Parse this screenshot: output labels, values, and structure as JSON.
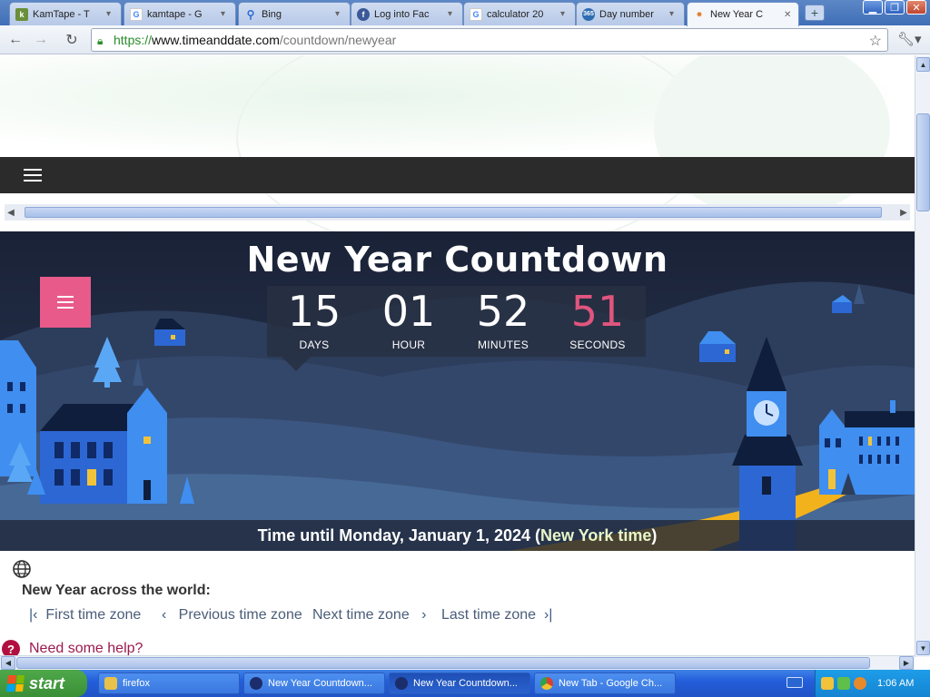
{
  "browser": {
    "tabs": [
      {
        "label": "KamTape - T",
        "favicon": "kamtape-icon",
        "color": "#6a8f3a"
      },
      {
        "label": "kamtape - G",
        "favicon": "google-icon",
        "color": "#4285f4"
      },
      {
        "label": "Bing",
        "favicon": "search-icon",
        "color": "#2d6bd1"
      },
      {
        "label": "Log into Fac",
        "favicon": "facebook-icon",
        "color": "#3b5998"
      },
      {
        "label": "calculator 20",
        "favicon": "google-icon",
        "color": "#4285f4"
      },
      {
        "label": "Day number",
        "favicon": "day365-icon",
        "color": "#2f6db3"
      },
      {
        "label": "New Year C",
        "favicon": "timeanddate-icon",
        "color": "#e07a22"
      }
    ],
    "url": {
      "scheme": "https://",
      "host": "www.timeanddate.com",
      "path": "/countdown/newyear"
    }
  },
  "page": {
    "title": "New Year Countdown",
    "countdown": [
      {
        "value": "15",
        "unit": "DAYS"
      },
      {
        "value": "01",
        "unit": "HOUR"
      },
      {
        "value": "52",
        "unit": "MINUTES"
      },
      {
        "value": "51",
        "unit": "SECONDS"
      }
    ],
    "time_until": {
      "prefix": "Time until Monday, January 1, 2024 (",
      "link": "New York time",
      "suffix": ")"
    },
    "world_heading": "New Year across the world:",
    "tz_nav": {
      "first": "First time zone",
      "previous": "Previous time zone",
      "next": "Next time zone",
      "last": "Last time zone"
    },
    "help": "Need some help?"
  },
  "taskbar": {
    "start": "start",
    "tasks": [
      {
        "label": "firefox",
        "icon": "folder-icon",
        "color": "#e8c14a"
      },
      {
        "label": "New Year Countdown...",
        "icon": "firefox-icon",
        "color": "#1b2d6b"
      },
      {
        "label": "New Year Countdown...",
        "icon": "firefox-icon",
        "color": "#1b2d6b"
      },
      {
        "label": "New Tab - Google Ch...",
        "icon": "chrome-icon",
        "color": "#d9412f"
      }
    ],
    "clock": "1:06 AM"
  },
  "colors": {
    "seconds": "#e0557f",
    "menu_pink": "#e85a8a",
    "link_green": "#2a8c2a",
    "help_red": "#9a1a4d"
  }
}
